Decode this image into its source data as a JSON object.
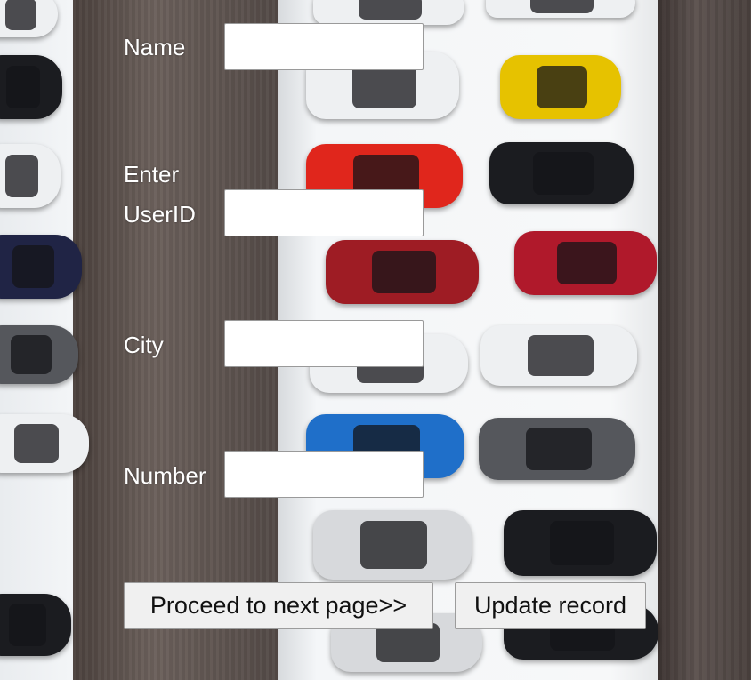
{
  "form": {
    "name_label": "Name",
    "userid_label_line1": "Enter",
    "userid_label_line2": "UserID",
    "city_label": "City",
    "number_label": "Number",
    "name_value": "",
    "userid_value": "",
    "city_value": "",
    "number_value": ""
  },
  "buttons": {
    "proceed_label": "Proceed to next page>>",
    "update_label": "Update record"
  },
  "background": {
    "description_icon": "aerial-parking-lot-image"
  }
}
